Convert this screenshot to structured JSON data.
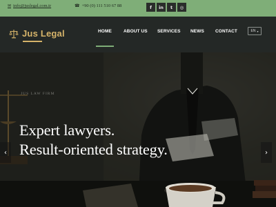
{
  "topbar": {
    "email": "info@juslegal.com.tr",
    "phone": "+90 (0) 111 510 67 88",
    "email_icon": "envelope-icon",
    "phone_icon": "phone-icon",
    "social": [
      {
        "icon": "facebook-icon",
        "glyph": "f"
      },
      {
        "icon": "linkedin-icon",
        "glyph": "in"
      },
      {
        "icon": "twitter-icon",
        "glyph": "t"
      },
      {
        "icon": "instagram-icon",
        "glyph": "◎"
      }
    ]
  },
  "brand": {
    "name": "Jus Legal",
    "accent": "#d6b46a",
    "green": "#7fae78"
  },
  "nav": {
    "items": [
      "HOME",
      "ABOUT US",
      "SERVICES",
      "NEWS",
      "CONTACT"
    ],
    "active": "HOME",
    "language": "EN"
  },
  "hero": {
    "kicker": "Jus Law Firm",
    "headline_line1": "Expert lawyers.",
    "headline_line2": "Result-oriented strategy.",
    "prev_arrow": "‹",
    "next_arrow": "›"
  }
}
